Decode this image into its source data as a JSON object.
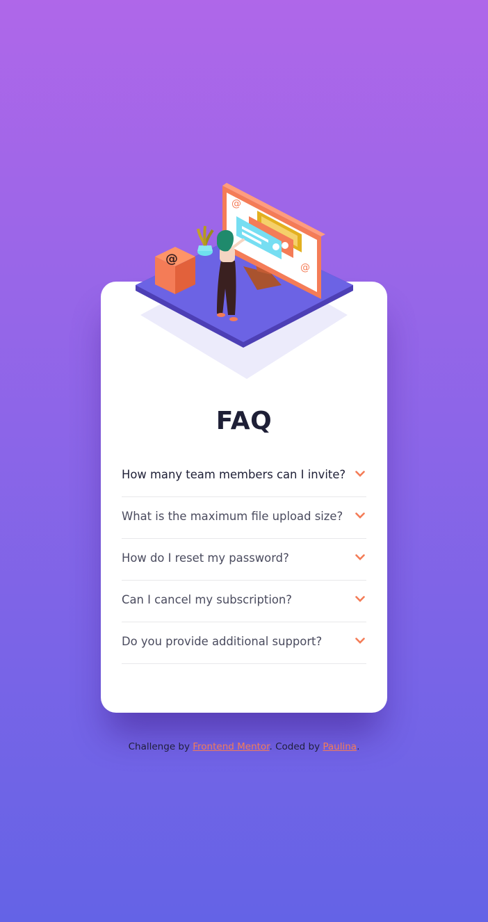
{
  "faq": {
    "title": "FAQ",
    "questions": [
      "How many team members can I invite?",
      "What is the maximum file upload size?",
      "How do I reset my password?",
      "Can I cancel my subscription?",
      "Do you provide additional support?"
    ],
    "chevron_icon": "chevron-down-icon",
    "accent_color": "#f47c57"
  },
  "footer": {
    "challenge_prefix": "Challenge by ",
    "challenge_link": "Frontend Mentor",
    "coded_prefix": ". Coded by ",
    "author_link": "Paulina",
    "suffix": "."
  },
  "colors": {
    "bg_top": "#af67e9",
    "bg_bottom": "#6463e6",
    "card": "#ffffff",
    "text_dark": "#1e1f36"
  }
}
